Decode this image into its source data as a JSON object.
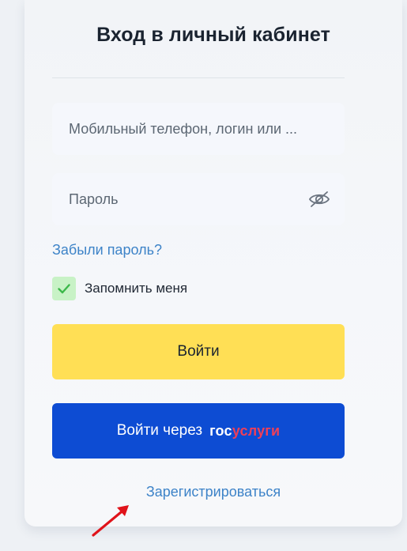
{
  "title": "Вход в личный кабинет",
  "login_field": {
    "placeholder": "Мобильный телефон, логин или ...",
    "value": ""
  },
  "password_field": {
    "placeholder": "Пароль",
    "value": "",
    "toggle_icon": "eye-off-icon"
  },
  "forgot_password": "Забыли пароль?",
  "remember_me": {
    "label": "Запомнить меня",
    "checked": true,
    "check_color": "#c8f2c6",
    "check_mark_color": "#3cb84a"
  },
  "login_button": {
    "label": "Войти",
    "color": "#ffdf55"
  },
  "gosuslugi_button": {
    "label": "Войти через",
    "logo_part1": "гос",
    "logo_part2": "услуги",
    "color": "#0d4cd3",
    "logo_accent_color": "#ee3f58"
  },
  "register_link": "Зарегистрироваться",
  "annotation": {
    "icon": "red-arrow-icon",
    "color": "#e0131a"
  }
}
